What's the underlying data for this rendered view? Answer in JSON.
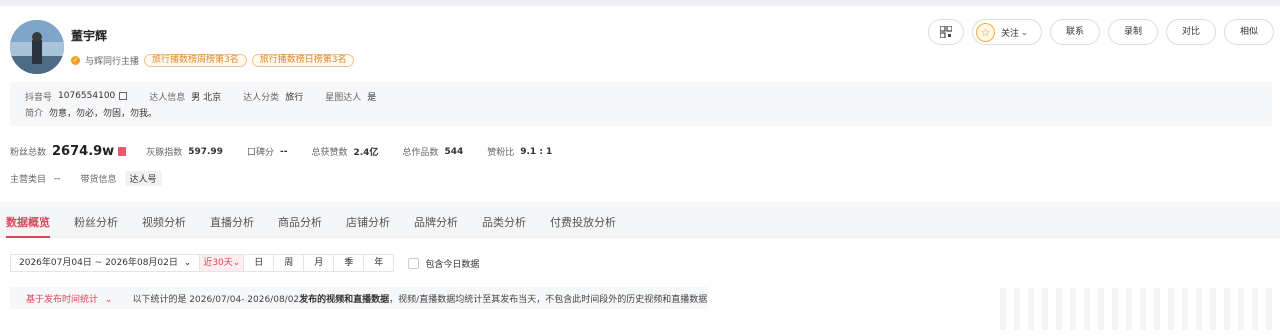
{
  "profile": {
    "name": "董宇辉",
    "verify_text": "与辉同行主播",
    "rank_tags": [
      "旅行播数榜周榜第3名",
      "旅行播数榜日榜第3名"
    ]
  },
  "actions": {
    "follow_label": "关注",
    "buttons": [
      "联系",
      "录制",
      "对比",
      "相似"
    ]
  },
  "info": {
    "douyin_label": "抖音号",
    "douyin_value": "1076554100",
    "talent_info_label": "达人信息",
    "talent_info_value": "男 北京",
    "category_label": "达人分类",
    "category_value": "旅行",
    "star_label": "星图达人",
    "star_value": "是",
    "bio_label": "简介",
    "bio_value": "勿意，勿必，勿固，勿我。"
  },
  "stats": {
    "fans_label": "粉丝总数",
    "fans_value": "2674.9w",
    "dolphin_label": "灰豚指数",
    "dolphin_value": "597.99",
    "reputation_label": "口碑分",
    "reputation_value": "--",
    "likes_label": "总获赞数",
    "likes_value": "2.4亿",
    "works_label": "总作品数",
    "works_value": "544",
    "ratio_label": "赞粉比",
    "ratio_value": "9.1 : 1"
  },
  "tags": {
    "main_category_label": "主营类目",
    "main_category_value": "--",
    "goods_label": "带货信息",
    "goods_value": "达人号"
  },
  "tabs": [
    "数据概览",
    "粉丝分析",
    "视频分析",
    "直播分析",
    "商品分析",
    "店铺分析",
    "品牌分析",
    "品类分析",
    "付费投放分析"
  ],
  "filter": {
    "date_range": "2026年07月04日 ~ 2026年08月02日",
    "segments": [
      "近30天",
      "日",
      "周",
      "月",
      "季",
      "年"
    ],
    "include_today": "包含今日数据"
  },
  "notice": {
    "tag": "基于发布时间统计",
    "text_prefix": "以下统计的是 2026/07/04- 2026/08/02 ",
    "text_bold": "发布的视频和直播数据",
    "text_suffix": "，视频/直播数据均统计至其发布当天，不包含此时间段外的历史视频和直播数据"
  },
  "colors": {
    "accent": "#e0445a",
    "rank_tag": "#e08a2a"
  }
}
